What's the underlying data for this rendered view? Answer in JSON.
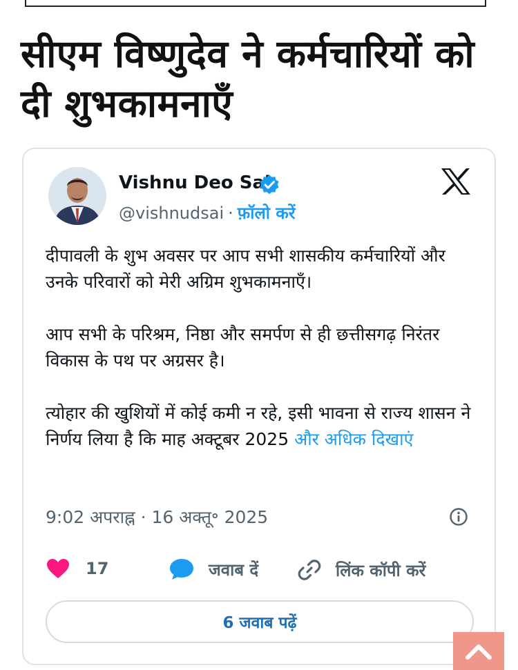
{
  "headline": "सीएम विष्णुदेव ने कर्मचारियों को दी शुभकामनाएँ",
  "tweet": {
    "author_name": "Vishnu Deo Sai",
    "handle": "@vishnudsai",
    "separator": "·",
    "follow_label": "फ़ॉलो करें",
    "paragraphs": [
      "दीपावली के शुभ अवसर पर आप सभी शासकीय कर्मचारियों और उनके परिवारों को मेरी अग्रिम शुभकामनाएँ।",
      "आप सभी के परिश्रम, निष्ठा और समर्पण से ही छत्तीसगढ़ निरंतर विकास के पथ पर अग्रसर है।",
      "त्योहार की खुशियों में कोई कमी न रहे, इसी भावना से राज्य शासन ने निर्णय लिया है कि माह अक्टूबर 2025 "
    ],
    "more_label": "और अधिक दिखाएं",
    "timestamp": "9:02 अपराह्न · 16 अक्तू॰ 2025",
    "like_count": "17",
    "reply_label": "जवाब दें",
    "copy_link_label": "लिंक कॉपी करें",
    "read_replies_label": "6 जवाब पढ़ें"
  },
  "icons": {
    "verified": "verified-badge-icon",
    "x_logo": "x-logo-icon",
    "info": "info-icon",
    "like": "heart-icon",
    "reply": "speech-bubble-icon",
    "copy_link": "link-icon",
    "scroll_top": "chevron-up-icon"
  },
  "colors": {
    "accent_blue": "#1d9bf0",
    "heart_pink": "#f91880",
    "scroll_top_bg": "#f0968b",
    "muted_text": "#536471"
  }
}
